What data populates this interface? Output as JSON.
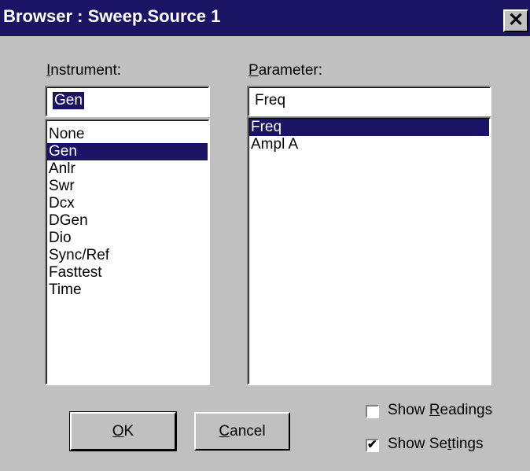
{
  "title": "Browser : Sweep.Source 1",
  "close_label": "✕",
  "instrument": {
    "label_first": "I",
    "label_rest": "nstrument:",
    "value": "Gen",
    "items": [
      "None",
      "Gen",
      "Anlr",
      "Swr",
      "Dcx",
      "DGen",
      "Dio",
      "Sync/Ref",
      "Fasttest",
      "Time"
    ],
    "selected": "Gen"
  },
  "parameter": {
    "label_first": "P",
    "label_rest": "arameter:",
    "value": "Freq",
    "items": [
      "Freq",
      "Ampl A"
    ],
    "selected": "Freq"
  },
  "buttons": {
    "ok_first": "O",
    "ok_rest": "K",
    "cancel_first": "C",
    "cancel_rest": "ancel"
  },
  "checkboxes": {
    "readings_pre": "Show ",
    "readings_u": "R",
    "readings_post": "eadings",
    "readings_checked": false,
    "settings_pre": "Show Se",
    "settings_u": "t",
    "settings_post": "tings",
    "settings_checked": true
  }
}
